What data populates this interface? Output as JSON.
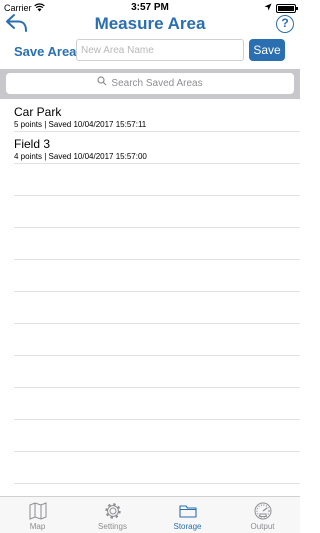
{
  "status": {
    "carrier": "Carrier",
    "time": "3:57 PM"
  },
  "header": {
    "title": "Measure Area",
    "help_label": "?"
  },
  "save": {
    "label": "Save Area",
    "placeholder": "New Area Name",
    "button_label": "Save"
  },
  "search": {
    "placeholder": "Search Saved Areas"
  },
  "areas": [
    {
      "name": "Car Park",
      "meta": "5 points | Saved 10/04/2017 15:57:11"
    },
    {
      "name": "Field 3",
      "meta": "4 points | Saved 10/04/2017 15:57:00"
    }
  ],
  "tabs": [
    {
      "label": "Map",
      "icon": "map-icon"
    },
    {
      "label": "Settings",
      "icon": "gear-icon"
    },
    {
      "label": "Storage",
      "icon": "folder-icon"
    },
    {
      "label": "Output",
      "icon": "gauge-icon"
    }
  ],
  "active_tab": "Storage",
  "colors": {
    "accent": "#2a6fb0",
    "inactive": "#8e8e93",
    "search_band": "#c8c8cc"
  }
}
